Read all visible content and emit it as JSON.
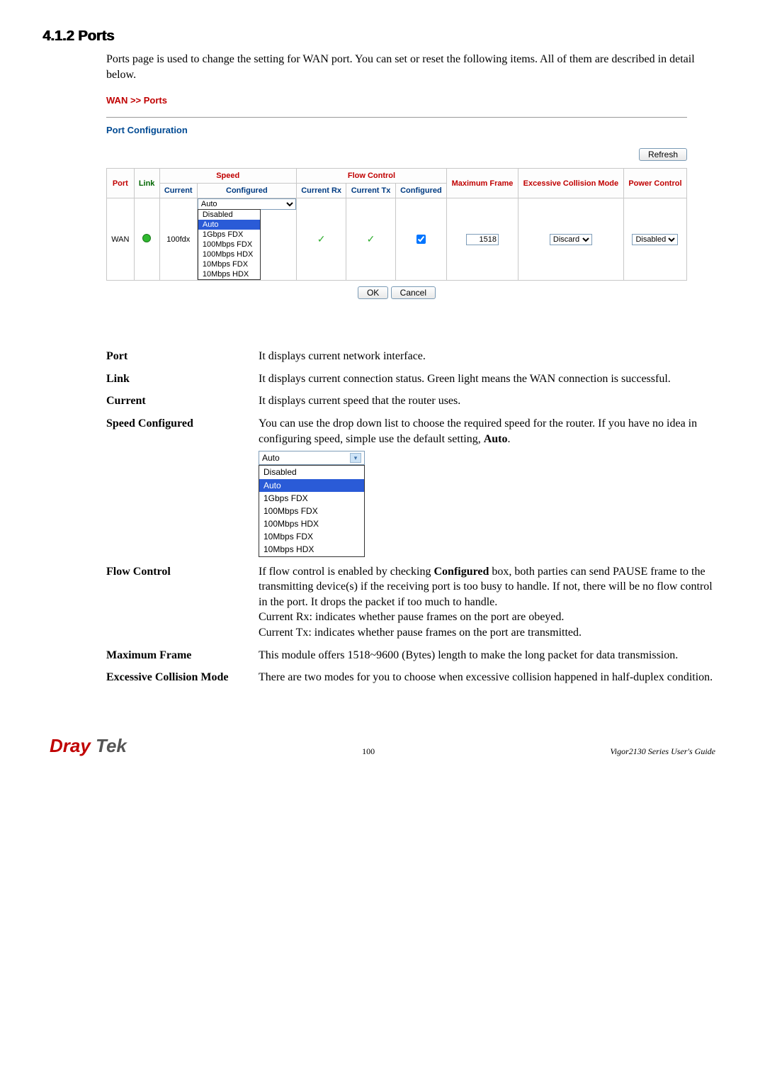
{
  "section": {
    "number": "4.1.2",
    "title": "Ports"
  },
  "intro": "Ports page is used to change the setting for WAN port. You can set or reset the following items. All of them are described in detail below.",
  "screenshot": {
    "breadcrumb": "WAN >> Ports",
    "subhead": "Port Configuration",
    "refresh": "Refresh",
    "headers": {
      "port": "Port",
      "link": "Link",
      "speed": "Speed",
      "current1": "Current",
      "configured1": "Configured",
      "flow": "Flow Control",
      "crx": "Current Rx",
      "ctx": "Current Tx",
      "configured2": "Configured",
      "maxframe": "Maximum Frame",
      "ecm": "Excessive Collision Mode",
      "power": "Power Control"
    },
    "row": {
      "port": "WAN",
      "current": "100fdx",
      "speed_sel": "Auto",
      "maxframe": "1518",
      "ecm_sel": "Discard",
      "power_sel": "Disabled"
    },
    "speed_options": [
      "Disabled",
      "Auto",
      "1Gbps FDX",
      "100Mbps FDX",
      "100Mbps HDX",
      "10Mbps FDX",
      "10Mbps HDX"
    ],
    "ok": "OK",
    "cancel": "Cancel"
  },
  "defs": {
    "port": {
      "term": "Port",
      "body": "It displays current network interface."
    },
    "link": {
      "term": "Link",
      "body": "It displays current connection status. Green light means the WAN connection is successful."
    },
    "current": {
      "term": "Current",
      "body": "It displays current speed that the router uses."
    },
    "speedcfg": {
      "term": "Speed Configured",
      "body_pre": "You can use the drop down list to choose the required speed for the router. If you have no idea in configuring speed, simple use the default setting, ",
      "body_bold": "Auto",
      "body_post": ".",
      "dd_value": "Auto",
      "options": [
        "Disabled",
        "Auto",
        "1Gbps FDX",
        "100Mbps FDX",
        "100Mbps HDX",
        "10Mbps FDX",
        "10Mbps HDX"
      ]
    },
    "flow": {
      "term": "Flow Control",
      "l1a": "If flow control is enabled by checking ",
      "l1b": "Configured",
      "l1c": " box, both parties can send PAUSE frame to the transmitting device(s) if the receiving port is too busy to handle. If not, there will be no flow control in the port. It drops the packet if too much to handle.",
      "l2": "Current Rx: indicates whether pause frames on the port are obeyed.",
      "l3": "Current Tx: indicates whether pause frames on the port are transmitted."
    },
    "maxframe": {
      "term": "Maximum Frame",
      "body": "This module offers 1518~9600 (Bytes) length to make the long packet for data transmission."
    },
    "ecm": {
      "term": "Excessive Collision Mode",
      "body": "There are two modes for you to choose when excessive collision happened in half-duplex condition."
    }
  },
  "footer": {
    "logo1": "Dray",
    "logo2": " Tek",
    "page": "100",
    "guide": "Vigor2130  Series  User's  Guide"
  }
}
